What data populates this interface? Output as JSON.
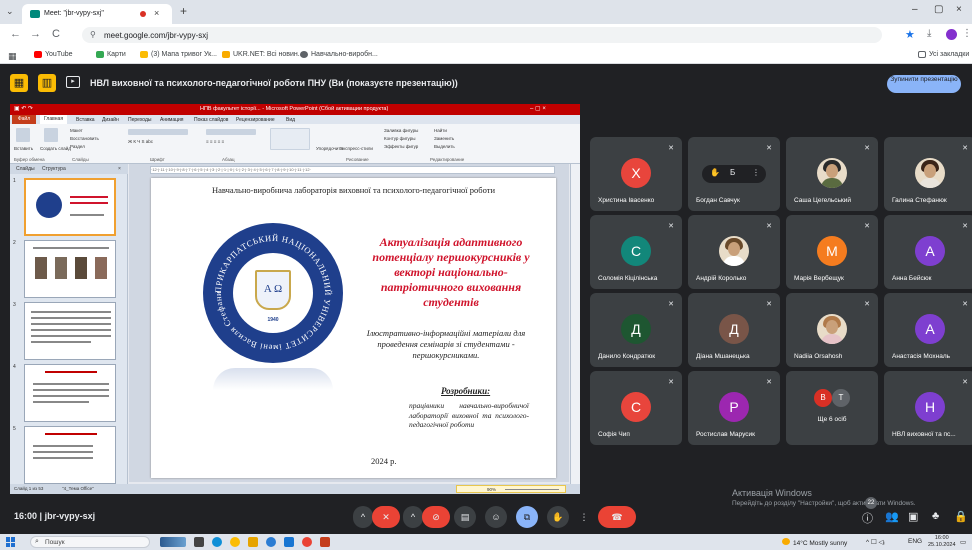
{
  "browser": {
    "tab_title": "Meet: \"jbr-vypy-sxj\"",
    "tab_close": "×",
    "new_tab": "+",
    "tabs_menu": "⌄",
    "win_min": "–",
    "win_max": "▢",
    "win_close": "×",
    "back": "←",
    "forward": "→",
    "reload": "C",
    "url": "meet.google.com/jbr-vypy-sxj",
    "star": "★",
    "download": "⤓",
    "menu": "⋮",
    "apps": "▦",
    "bookmarks": [
      {
        "label": "YouTube",
        "color": "#ff0000"
      },
      {
        "label": "Карти",
        "color": "#34a853"
      },
      {
        "label": "(3) Мапа тривог Ук...",
        "color": "#fbbc04"
      },
      {
        "label": "UKR.NET: Всі новин...",
        "color": "#f9ab00"
      },
      {
        "label": "Навчально-виробн...",
        "color": "#5f6368"
      }
    ],
    "all_bookmarks": "Усі закладки"
  },
  "meet": {
    "presenting_text": "НВЛ виховної та психолого-педагогічної роботи ПНУ (Ви (показуєте презентацію))",
    "stop_button": "Зупинити презентацію",
    "meeting_time": "16:00",
    "separator": "|",
    "meeting_code": "jbr-vypy-sxj",
    "overlay_badge_count": "22",
    "activate_windows_title": "Активація Windows",
    "activate_windows_sub": "Перейдіть до розділу \"Настройки\", щоб активувати Windows."
  },
  "controls": {
    "chevron": "^",
    "mic": "✕",
    "cam": "⊘",
    "captions": "▤",
    "emoji": "☺",
    "present": "⧉",
    "hand": "✋",
    "more": "⋮",
    "hangup": "☎",
    "info": "ⓘ",
    "people": "👥",
    "chat": "▣",
    "activities": "♣",
    "lock": "🔒"
  },
  "ppt": {
    "window_title": "НПВ факультет історії... - Microsoft PowerPoint (Сбой активации продукта)",
    "quick_access": "▣ ↶ ↷",
    "win_controls": "–  ▢  ×",
    "tabs": [
      "Файл",
      "Главная",
      "Вставка",
      "Дизайн",
      "Переходы",
      "Анимация",
      "Показ слайдов",
      "Рецензирование",
      "Вид"
    ],
    "groups": [
      "Буфер обмена",
      "Слайды",
      "Шрифт",
      "Абзац",
      "Рисование",
      "Редактирование"
    ],
    "ribbon_items": [
      "Вставить",
      "Создать слайд",
      "Макет",
      "Восстановить",
      "Раздел",
      "Упорядочить",
      "Экспресс-стили",
      "Заливка фигуры",
      "Контур фигуры",
      "Эффекты фигур",
      "Найти",
      "Заменить",
      "Выделить"
    ],
    "pane_tabs": [
      "Слайды",
      "Структура"
    ],
    "pane_close": "×",
    "ruler_text": "·12·|·11·|·10·|·9·|·8·|·7·|·6·|·5·|·4·|·3·|·2·|·1·|·0·|·1·|·2·|·3·|·4·|·5·|·6·|·7·|·8·|·9·|·10·|·11·|·12·",
    "thumb_numbers": [
      "1",
      "2",
      "3",
      "4",
      "5"
    ],
    "status_left": "Слайд 1 из 53",
    "status_theme": "\"4_Тема Office\"",
    "zoom": "90%"
  },
  "slide": {
    "header": "Навчально-виробнича лабораторія виховної та психолого-педагогічної роботи",
    "title": "Актуалізація адаптивного потенціалу першокурсників у векторі національно-патріотичного виховання студентів",
    "subtitle": "Ілюстративно-інформаційні матеріали для проведення семінарів зі студентами - першокурсниками.",
    "developers_heading": "Розробники:",
    "developers": "працівники навчально-виробничої лабораторії виховної та психолого-педагогічної роботи",
    "year": "2024 р.",
    "emblem_text": "ПРИКАРПАТСЬКИЙ НАЦІОНАЛЬНИЙ УНІВЕРСИТЕТ імені Василя Стефаника",
    "emblem_letters": "Α Ω",
    "emblem_year": "1940"
  },
  "participants": [
    {
      "name": "Христина Івасенко",
      "initial": "Х",
      "color": "#e8453c"
    },
    {
      "name": "Богдан Савчук",
      "initial": "",
      "color": "#3c4043"
    },
    {
      "name": "Саша Цегельський",
      "initial": "",
      "color": "#3c4043"
    },
    {
      "name": "Галина Стефанюк",
      "initial": "",
      "color": "#3c4043"
    },
    {
      "name": "Соломія Кіцілінська",
      "initial": "С",
      "color": "#12877a"
    },
    {
      "name": "Андрій Королько",
      "initial": "",
      "color": "#3c4043"
    },
    {
      "name": "Марія Вербещук",
      "initial": "М",
      "color": "#f57c1f"
    },
    {
      "name": "Анна Бейсюк",
      "initial": "А",
      "color": "#7e3fd0"
    },
    {
      "name": "Данило Кондратюк",
      "initial": "Д",
      "color": "#1e5631"
    },
    {
      "name": "Діана Мшанецька",
      "initial": "Д",
      "color": "#795548"
    },
    {
      "name": "Nadiia Orsahosh",
      "initial": "",
      "color": "#3c4043"
    },
    {
      "name": "Анастасія Мохналь",
      "initial": "А",
      "color": "#7e3fd0"
    },
    {
      "name": "Софія Чип",
      "initial": "С",
      "color": "#e8453c"
    },
    {
      "name": "Ростислав Марусик",
      "initial": "Р",
      "color": "#9c27b0"
    },
    {
      "name": "Ще 6 осіб",
      "initial": "",
      "color": "#3c4043"
    },
    {
      "name": "НВЛ виховної та пс...",
      "initial": "Н",
      "color": "#7e3fd0"
    }
  ],
  "tile_overlay": [
    "✋",
    "Б",
    "⋮"
  ],
  "more_people_bubbles": [
    "В",
    "Т"
  ],
  "mute_icon": "✕",
  "taskbar": {
    "search_placeholder": "Пошук",
    "search_icon": "⌕",
    "weather": "14°C  Mostly sunny",
    "tray_icons": "^ ☐ ◁ᵢ",
    "lang": "ENG",
    "time": "16:00",
    "date": "25.10.2024",
    "notify": "▭"
  }
}
